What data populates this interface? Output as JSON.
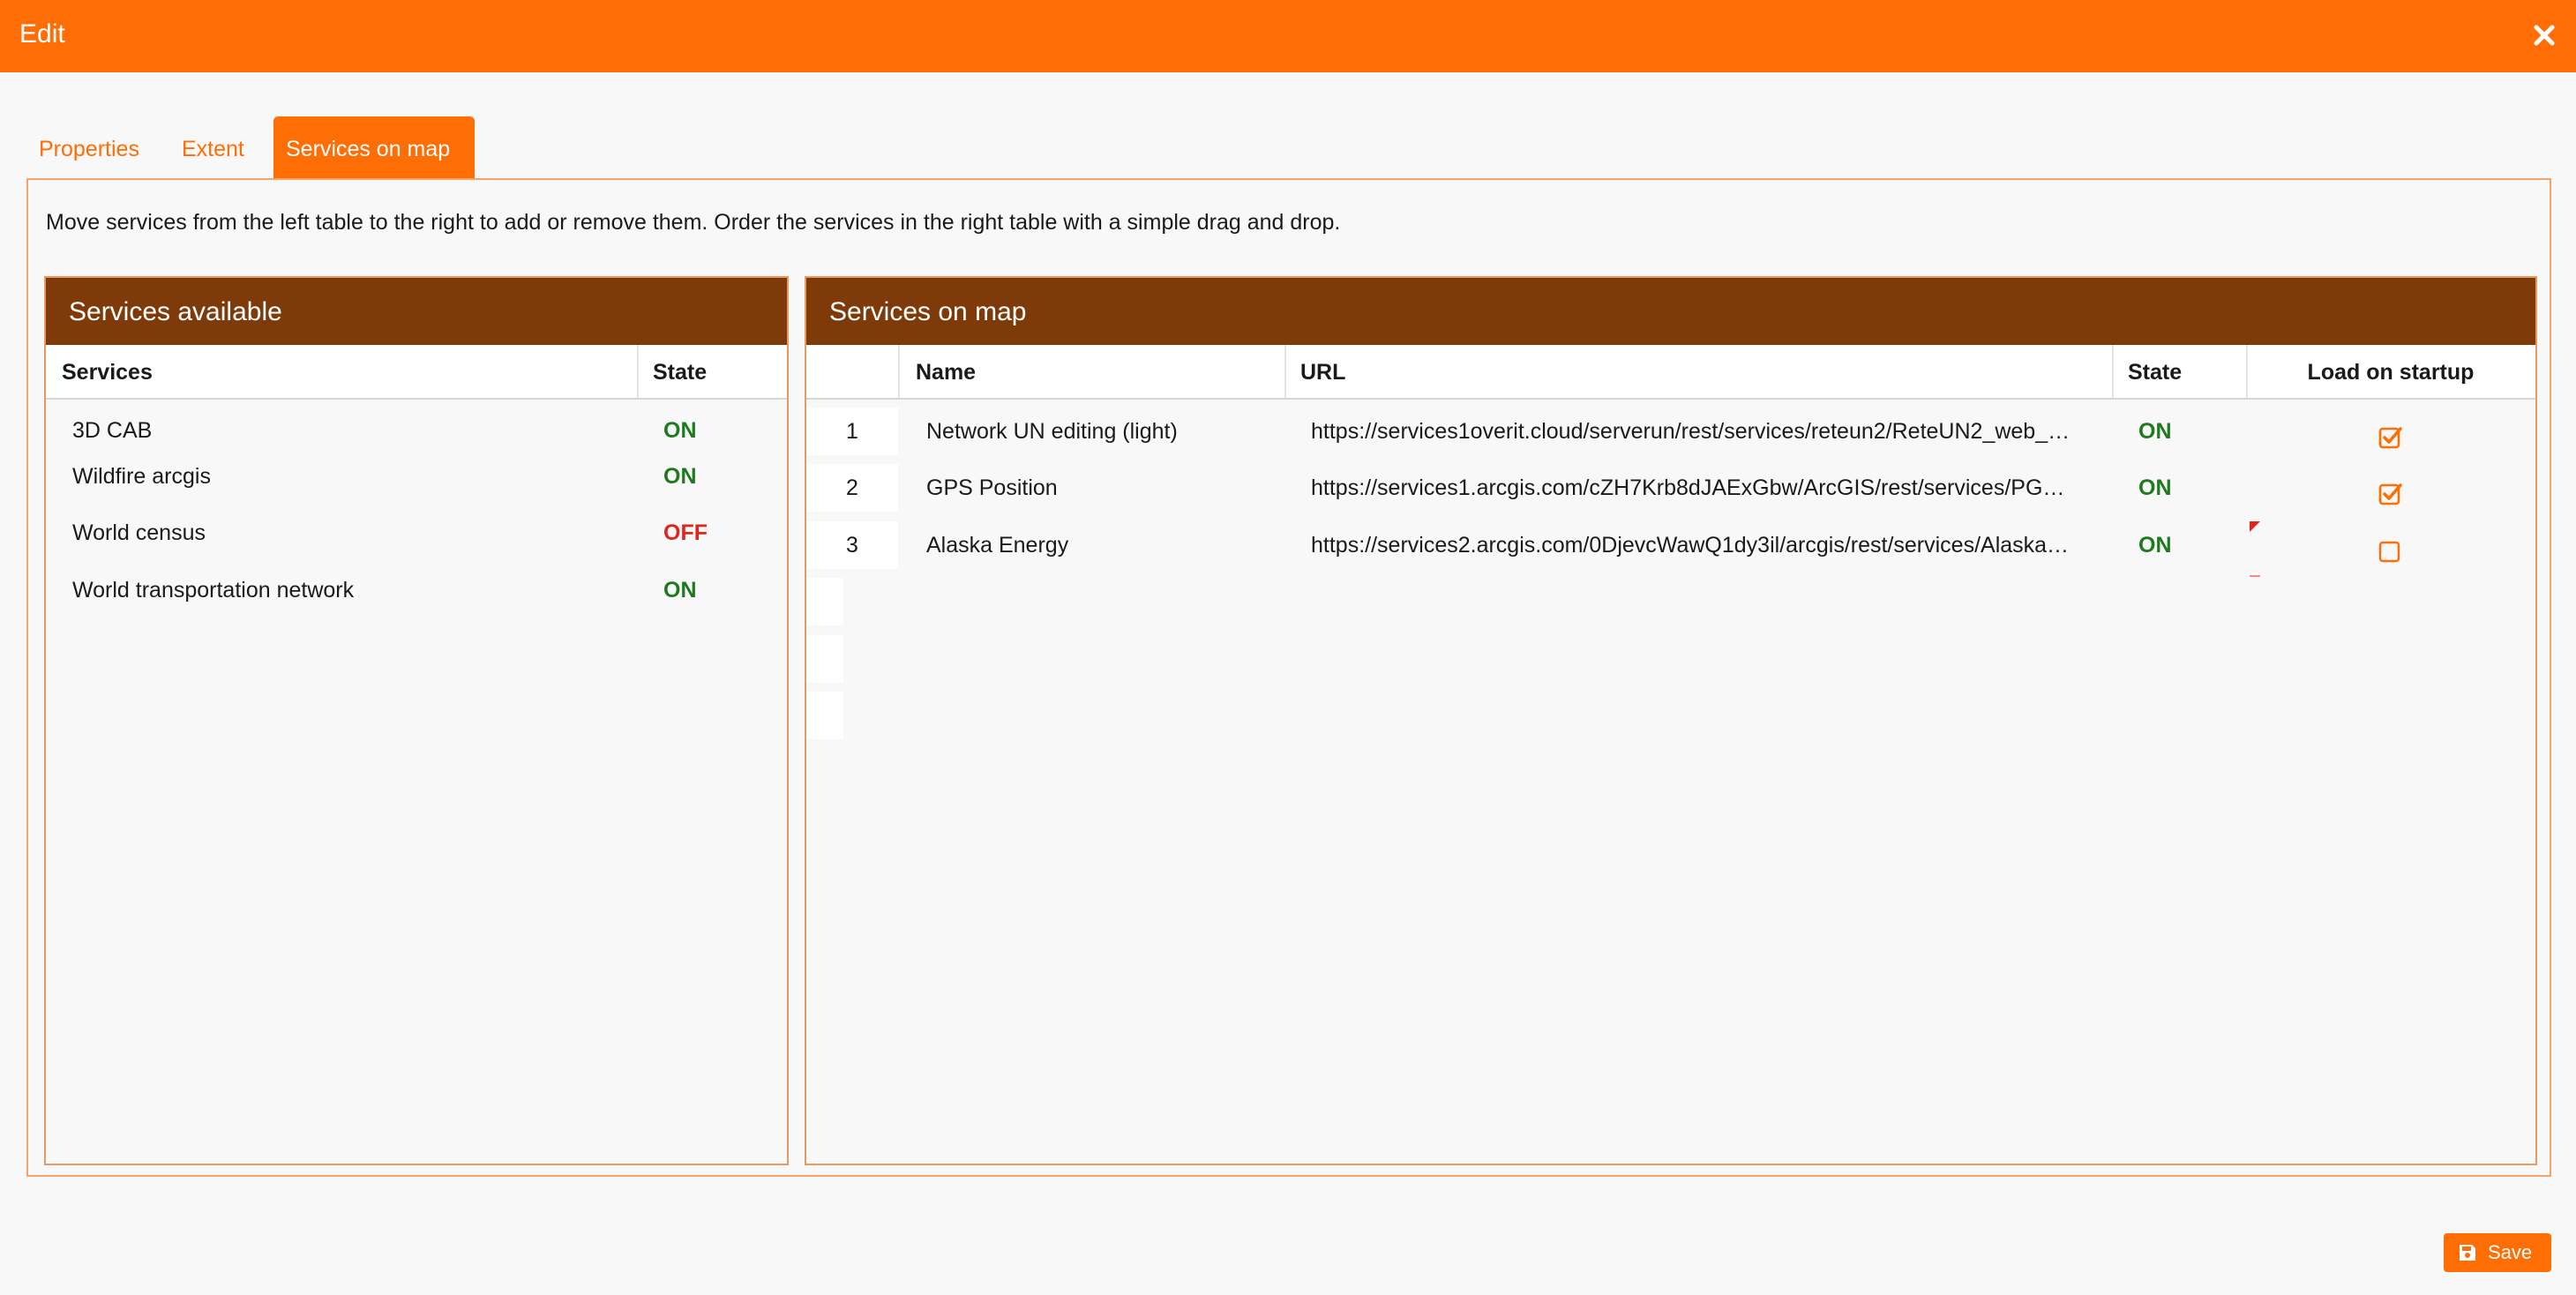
{
  "dialog": {
    "title": "Edit"
  },
  "tabs": [
    {
      "label": "Properties",
      "active": false
    },
    {
      "label": "Extent",
      "active": false
    },
    {
      "label": "Services on map",
      "active": true
    }
  ],
  "instructions": "Move services from the left table to the right to add or remove them. Order the services in the right table with a simple drag and drop.",
  "available": {
    "title": "Services available",
    "columns": [
      "Services",
      "State"
    ],
    "rows": [
      {
        "name": "3D CAB",
        "state": "ON"
      },
      {
        "name": "Wildfire arcgis",
        "state": "ON"
      },
      {
        "name": "World census",
        "state": "OFF"
      },
      {
        "name": "World transportation network",
        "state": "ON"
      }
    ]
  },
  "onmap": {
    "title": "Services on map",
    "columns": [
      "Name",
      "URL",
      "State",
      "Load on startup"
    ],
    "rows": [
      {
        "index": "1",
        "name": "Network UN editing (light)",
        "url": "https://services1overit.cloud/serverun/rest/services/reteun2/ReteUN2_web_…",
        "state": "ON",
        "load": true
      },
      {
        "index": "2",
        "name": "GPS Position",
        "url": "https://services1.arcgis.com/cZH7Krb8dJAExGbw/ArcGIS/rest/services/PG…",
        "state": "ON",
        "load": true
      },
      {
        "index": "3",
        "name": "Alaska Energy",
        "url": "https://services2.arcgis.com/0DjevcWawQ1dy3il/arcgis/rest/services/Alaska…",
        "state": "ON",
        "load": false
      }
    ]
  },
  "footer": {
    "save_label": "Save"
  },
  "colors": {
    "accent": "#ff6d05",
    "header_brown": "#7f3a0a",
    "on": "#1f7a1f",
    "off": "#e0261c"
  }
}
